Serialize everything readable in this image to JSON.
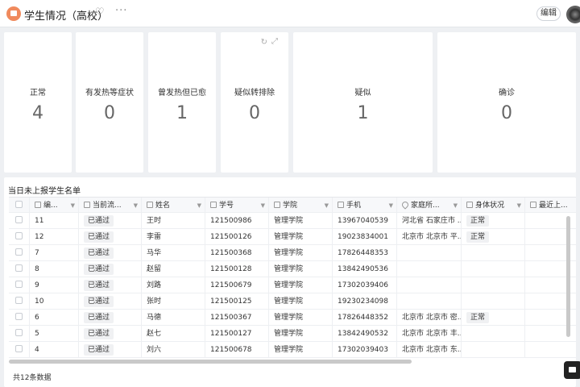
{
  "header": {
    "title": "学生情况（高校）",
    "favorite_icon": "heart-icon",
    "more_icon": "ellipsis-icon",
    "edit_label": "编辑",
    "accent_color": "#f08a5d"
  },
  "cards": [
    {
      "label": "正常",
      "value": "4"
    },
    {
      "label": "有发热等症状",
      "value": "0"
    },
    {
      "label": "曾发热但已愈",
      "value": "1"
    },
    {
      "label": "疑似转排除",
      "value": "0"
    },
    {
      "label": "疑似",
      "value": "1"
    },
    {
      "label": "确诊",
      "value": "0"
    }
  ],
  "card_tools": {
    "refresh_icon": "refresh-icon",
    "expand_icon": "expand-icon"
  },
  "table": {
    "title": "当日未上报学生名单",
    "columns": [
      "编...",
      "当前流...",
      "姓名",
      "学号",
      "学院",
      "手机",
      "家庭所...",
      "身体状况",
      "最近上..."
    ],
    "rows": [
      [
        "11",
        "已通过",
        "王时",
        "121500986",
        "管理学院",
        "13967040539",
        "河北省 石家庄市 ...",
        "正常",
        ""
      ],
      [
        "12",
        "已通过",
        "李雷",
        "121500126",
        "管理学院",
        "19023834001",
        "北京市 北京市 平...",
        "正常",
        ""
      ],
      [
        "7",
        "已通过",
        "马华",
        "121500368",
        "管理学院",
        "17826448353",
        "",
        "",
        ""
      ],
      [
        "8",
        "已通过",
        "赵留",
        "121500128",
        "管理学院",
        "13842490536",
        "",
        "",
        ""
      ],
      [
        "9",
        "已通过",
        "刘路",
        "121500679",
        "管理学院",
        "17302039406",
        "",
        "",
        ""
      ],
      [
        "10",
        "已通过",
        "张时",
        "121500125",
        "管理学院",
        "19230234098",
        "",
        "",
        ""
      ],
      [
        "6",
        "已通过",
        "马德",
        "121500367",
        "管理学院",
        "17826448352",
        "北京市 北京市 密...",
        "正常",
        ""
      ],
      [
        "5",
        "已通过",
        "赵七",
        "121500127",
        "管理学院",
        "13842490532",
        "北京市 北京市 丰...",
        "",
        ""
      ],
      [
        "4",
        "已通过",
        "刘六",
        "121500678",
        "管理学院",
        "17302039403",
        "北京市 北京市 东...",
        "",
        ""
      ]
    ],
    "footer": "共12条数据"
  }
}
